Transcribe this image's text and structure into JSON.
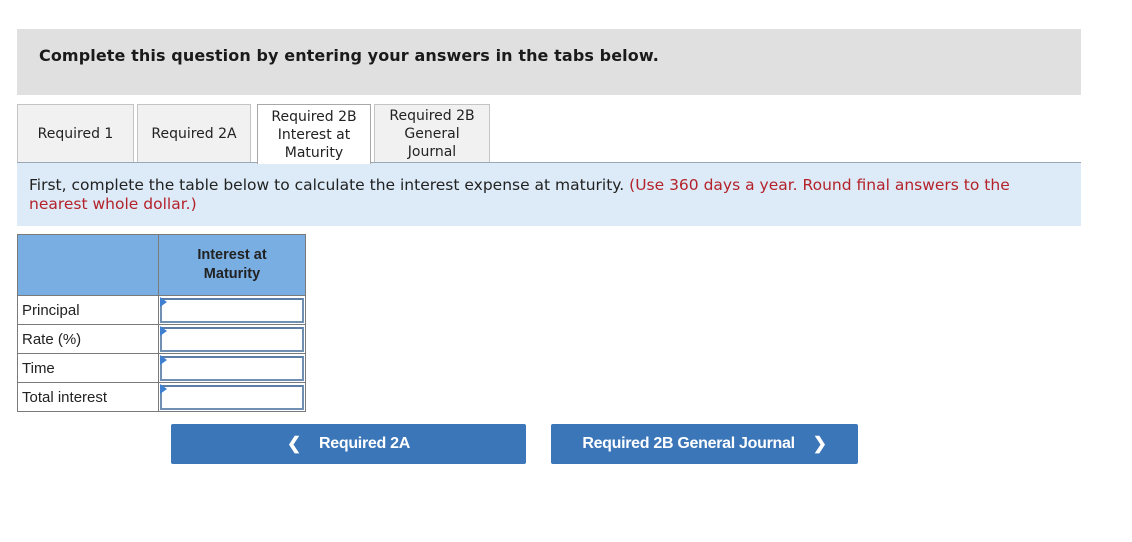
{
  "instructions": "Complete this question by entering your answers in the tabs below.",
  "tabs": [
    {
      "lines": [
        "Required 1"
      ],
      "active": false
    },
    {
      "lines": [
        "Required 2A"
      ],
      "active": false
    },
    {
      "lines": [
        "Required 2B",
        "Interest at",
        "Maturity"
      ],
      "active": true
    },
    {
      "lines": [
        "Required 2B",
        "General",
        "Journal"
      ],
      "active": false
    }
  ],
  "question": {
    "text": "First, complete the table below to calculate the interest expense at maturity.",
    "note": "(Use 360 days a year. Round final answers to the nearest whole dollar.)"
  },
  "table": {
    "header": [
      "",
      "Interest at Maturity"
    ],
    "header_lines": [
      "Interest at",
      "Maturity"
    ],
    "rows": [
      {
        "label": "Principal",
        "value": ""
      },
      {
        "label": "Rate (%)",
        "value": ""
      },
      {
        "label": "Time",
        "value": ""
      },
      {
        "label": "Total interest",
        "value": ""
      }
    ]
  },
  "nav": {
    "prev_label": "Required 2A",
    "next_label": "Required 2B General Journal",
    "prev_icon": "chevron-left-icon",
    "next_icon": "chevron-right-icon",
    "button_color": "#3b76b9"
  },
  "colors": {
    "banner": "#e0e0e0",
    "question_bg": "#dcebf7",
    "note_red": "#b4222a",
    "table_header": "#79aee3"
  }
}
